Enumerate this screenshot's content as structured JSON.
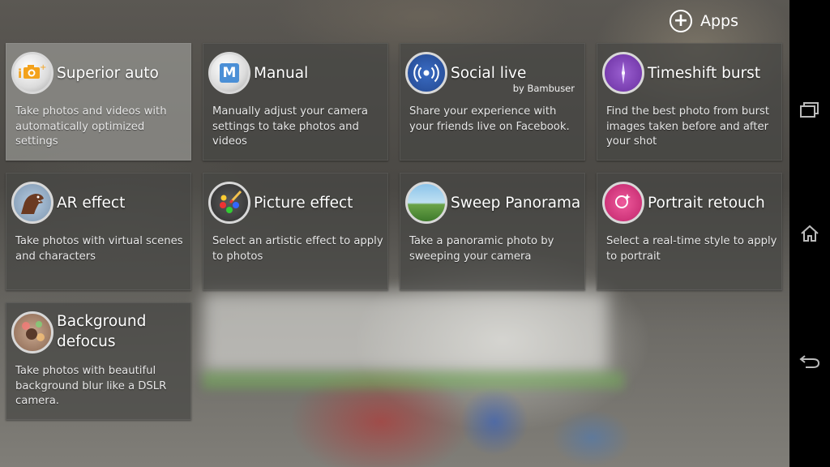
{
  "topbar": {
    "apps_label": "Apps"
  },
  "tiles": [
    {
      "title": "Superior auto",
      "description": "Take photos and videos with automatically optimized settings"
    },
    {
      "title": "Manual",
      "description": "Manually adjust your camera settings to take photos and videos",
      "icon_letter": "M"
    },
    {
      "title": "Social live",
      "subtitle": "by Bambuser",
      "description": "Share your experience with your friends live on Facebook."
    },
    {
      "title": "Timeshift burst",
      "description": "Find the best photo from burst images taken before and after your shot"
    },
    {
      "title": "AR effect",
      "description": "Take photos with virtual scenes and characters"
    },
    {
      "title": "Picture effect",
      "description": "Select an artistic effect to apply to photos"
    },
    {
      "title": "Sweep Panorama",
      "description": "Take a panoramic photo by sweeping your camera"
    },
    {
      "title": "Portrait retouch",
      "description": "Select a real-time style to apply to portrait"
    },
    {
      "title": "Background defocus",
      "description": "Take photos with beautiful background blur like a DSLR camera."
    }
  ],
  "colors": {
    "superior_auto_accent": "#f3a21c",
    "manual_accent": "#4b8fd6",
    "social_live_accent": "#2d5fb5",
    "timeshift_accent": "#7a3fb1",
    "portrait_accent": "#d8367f"
  }
}
